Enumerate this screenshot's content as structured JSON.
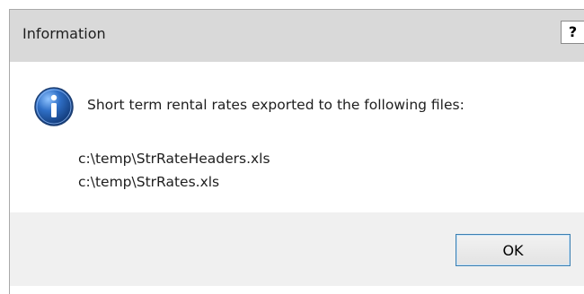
{
  "window": {
    "title": "Information",
    "help_label": "?"
  },
  "dialog": {
    "icon": "information-icon",
    "message": "Short term rental rates exported to the following files:",
    "files": [
      "c:\\temp\\StrRateHeaders.xls",
      "c:\\temp\\StrRates.xls"
    ]
  },
  "buttons": {
    "ok_label": "OK"
  },
  "colors": {
    "titlebar": "#d9d9d9",
    "footer": "#f0f0f0",
    "icon_blue": "#2f6fc6",
    "button_border": "#3c7fb1"
  }
}
